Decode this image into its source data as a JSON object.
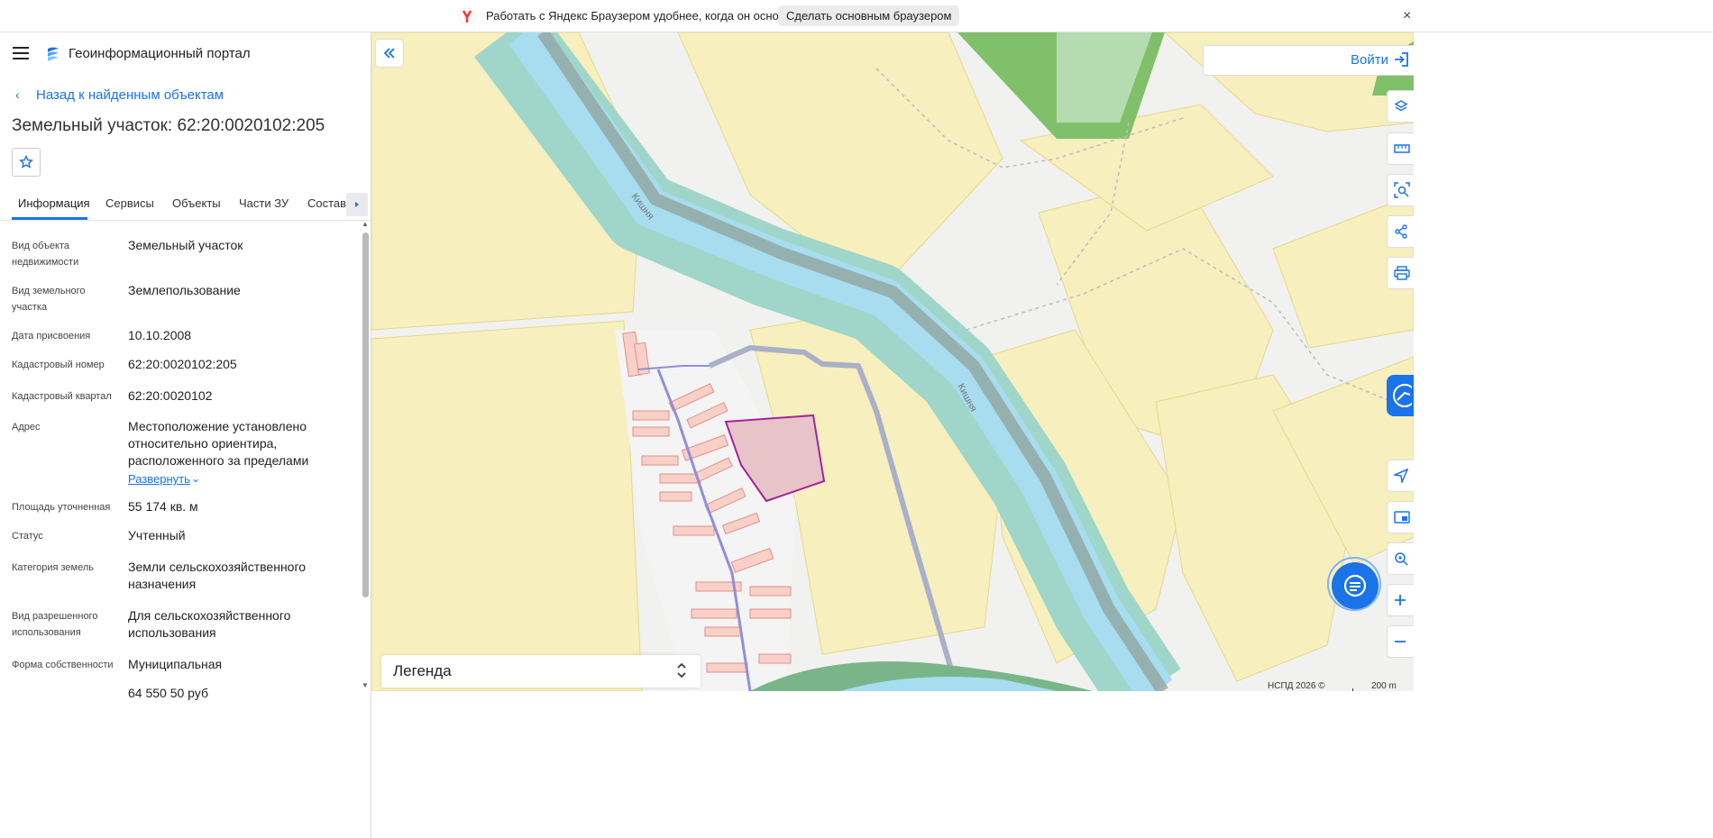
{
  "browser_banner": {
    "text": "Работать с Яндекс Браузером удобнее, когда он основной",
    "button_label": "Сделать основным браузером",
    "close_icon": "×"
  },
  "header": {
    "portal_title": "Геоинформационный портал"
  },
  "nav": {
    "back_label": "Назад к найденным объектам"
  },
  "object": {
    "title": "Земельный участок: 62:20:0020102:205"
  },
  "tabs": [
    {
      "label": "Информация",
      "active": true
    },
    {
      "label": "Сервисы",
      "active": false
    },
    {
      "label": "Объекты",
      "active": false
    },
    {
      "label": "Части ЗУ",
      "active": false
    },
    {
      "label": "Состав",
      "active": false
    }
  ],
  "info_rows": [
    {
      "label": "Вид объекта недвижимости",
      "value": "Земельный участок"
    },
    {
      "label": "Вид земельного участка",
      "value": "Землепользование"
    },
    {
      "label": "Дата присвоения",
      "value": "10.10.2008"
    },
    {
      "label": "Кадастровый номер",
      "value": "62:20:0020102:205"
    },
    {
      "label": "Кадастровый квартал",
      "value": "62:20:0020102"
    },
    {
      "label": "Адрес",
      "value": "Местоположение установлено относительно ориентира, расположенного за пределами"
    },
    {
      "label": "Площадь уточненная",
      "value": "55 174 кв. м"
    },
    {
      "label": "Статус",
      "value": "Учтенный"
    },
    {
      "label": "Категория земель",
      "value": "Земли сельскохозяйственного назначения"
    },
    {
      "label": "Вид разрешенного использования",
      "value": "Для сельскохозяйственного использования"
    },
    {
      "label": "Форма собственности",
      "value": "Муниципальная"
    }
  ],
  "expand_label": "Развернуть",
  "clipped_value": "64 550 50 руб",
  "map": {
    "login_label": "Войти",
    "river_label": "Кишня",
    "legend_label": "Легенда",
    "copyright": "НСПД 2026 ©",
    "scale": "200 m",
    "tools": [
      "layers-icon",
      "ruler-icon",
      "area-search-icon",
      "share-icon",
      "print-icon",
      "locate-icon",
      "minimap-icon",
      "geo-search-icon",
      "zoom-in-icon",
      "zoom-out-icon"
    ]
  },
  "colors": {
    "accent": "#1a73e8",
    "parcel_fill": "#e8c4c8",
    "parcel_stroke": "#a3239f",
    "river": "#a8dcef",
    "buffer": "#9fd6c9",
    "agri_land": "#f7efbe"
  }
}
